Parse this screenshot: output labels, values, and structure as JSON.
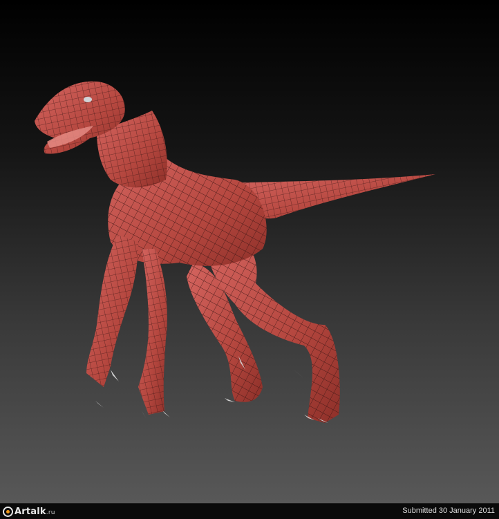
{
  "image": {
    "subject": "3d-raptor-model",
    "body_color": "#c0504c",
    "wire_color": "#3a1514",
    "claw_color": "#cfcfcf",
    "eye_color": "#d0d4d8"
  },
  "footer": {
    "logo_name": "Artalk",
    "logo_tld": ".ru",
    "submitted_text": "Submitted 30 January 2011",
    "accent_color": "#f29a18"
  }
}
